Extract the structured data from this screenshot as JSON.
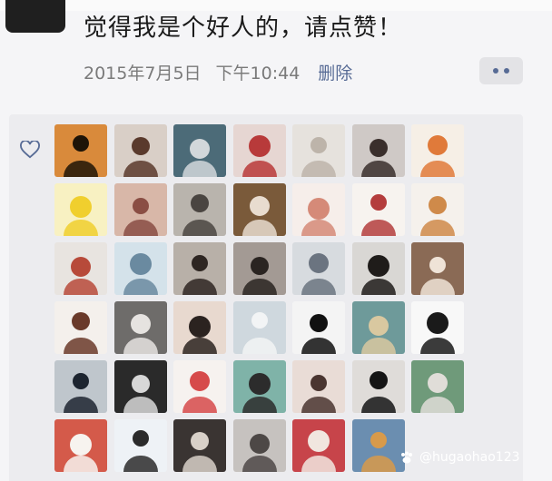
{
  "post": {
    "text": "觉得我是个好人的，请点赞！",
    "date": "2015年7月5日",
    "time": "下午10:44",
    "delete_label": "删除",
    "more_icon": "more-dots-icon"
  },
  "likes": {
    "icon": "heart-outline-icon",
    "avatars": [
      {
        "name": "avatar-buddha-sunset",
        "bg": "#d98a3b",
        "fg": "#1e1407"
      },
      {
        "name": "avatar-girl-portrait",
        "bg": "#d9cfc7",
        "fg": "#5a3a2c"
      },
      {
        "name": "avatar-boy-glasses",
        "bg": "#4c6b78",
        "fg": "#d2d7da"
      },
      {
        "name": "avatar-girl-red",
        "bg": "#e6d6d2",
        "fg": "#b83a3a"
      },
      {
        "name": "avatar-white-cat",
        "bg": "#e6e2dd",
        "fg": "#bdb4aa"
      },
      {
        "name": "avatar-woman-selfie",
        "bg": "#cfc9c6",
        "fg": "#3a2f2c"
      },
      {
        "name": "avatar-cartoon-girl",
        "bg": "#f6efe6",
        "fg": "#e07a3a"
      },
      {
        "name": "avatar-yellow-figure",
        "bg": "#f8f1c2",
        "fg": "#f0cf2e"
      },
      {
        "name": "avatar-group-photo",
        "bg": "#d8b7a8",
        "fg": "#8a4e44"
      },
      {
        "name": "avatar-man-hat",
        "bg": "#b9b4ad",
        "fg": "#4a4541"
      },
      {
        "name": "avatar-chocolate-box",
        "bg": "#7a5a3a",
        "fg": "#e8dccf"
      },
      {
        "name": "avatar-pink-logo",
        "bg": "#f6eeea",
        "fg": "#d58a78"
      },
      {
        "name": "avatar-hanzi-art",
        "bg": "#f7f3ef",
        "fg": "#b43d3d"
      },
      {
        "name": "avatar-cartoon-man",
        "bg": "#f5f1ec",
        "fg": "#cf8a4a"
      },
      {
        "name": "avatar-boy-red",
        "bg": "#e8e4e0",
        "fg": "#b74a3a"
      },
      {
        "name": "avatar-beach-figure",
        "bg": "#d4e2ea",
        "fg": "#6a8aa0"
      },
      {
        "name": "avatar-sunglasses-girl",
        "bg": "#b8b0a8",
        "fg": "#2e2622"
      },
      {
        "name": "avatar-woman-bw",
        "bg": "#a39a94",
        "fg": "#2a2421"
      },
      {
        "name": "avatar-kid-hat",
        "bg": "#d7dbdf",
        "fg": "#6b7480"
      },
      {
        "name": "avatar-sitting-woman",
        "bg": "#d9d7d4",
        "fg": "#1f1c1a"
      },
      {
        "name": "avatar-cafe-woman",
        "bg": "#8a6a55",
        "fg": "#efe3d7"
      },
      {
        "name": "avatar-baby-cartoon",
        "bg": "#f4f0ec",
        "fg": "#6a3a2a"
      },
      {
        "name": "avatar-man-bw",
        "bg": "#6e6c6a",
        "fg": "#e6e3e0"
      },
      {
        "name": "avatar-baby-face",
        "bg": "#e8d9cf",
        "fg": "#2b2320"
      },
      {
        "name": "avatar-seagull",
        "bg": "#cfd8de",
        "fg": "#f2f4f5"
      },
      {
        "name": "avatar-mountain-logo",
        "bg": "#f4f4f4",
        "fg": "#111111"
      },
      {
        "name": "avatar-sea-rock",
        "bg": "#6e9a9a",
        "fg": "#d9c8a0"
      },
      {
        "name": "avatar-sketch-person",
        "bg": "#f8f8f8",
        "fg": "#1a1a1a"
      },
      {
        "name": "avatar-man-suit",
        "bg": "#bfc6cc",
        "fg": "#1d2530"
      },
      {
        "name": "avatar-bw-girl",
        "bg": "#2a2a2a",
        "fg": "#d7d7d7"
      },
      {
        "name": "avatar-red-mouth-girl",
        "bg": "#f6f2ef",
        "fg": "#d64a4a"
      },
      {
        "name": "avatar-tiger-badge",
        "bg": "#7fb3a8",
        "fg": "#2c2c2c"
      },
      {
        "name": "avatar-face-closeup",
        "bg": "#e9dcd6",
        "fg": "#4a3530"
      },
      {
        "name": "avatar-peace-hair",
        "bg": "#dfdcd9",
        "fg": "#151515"
      },
      {
        "name": "avatar-window-plant",
        "bg": "#6f9a7a",
        "fg": "#e0ddd8"
      },
      {
        "name": "avatar-boy-white",
        "bg": "#d45a4a",
        "fg": "#f7f3ef"
      },
      {
        "name": "avatar-anime-couple",
        "bg": "#eef2f6",
        "fg": "#2b2b2b"
      },
      {
        "name": "avatar-dark-room",
        "bg": "#3a3432",
        "fg": "#d8d0c8"
      },
      {
        "name": "avatar-grey-pattern",
        "bg": "#c6c2bf",
        "fg": "#4d4846"
      },
      {
        "name": "avatar-girl-bow",
        "bg": "#c7444a",
        "fg": "#f1e6df"
      },
      {
        "name": "avatar-city-sea",
        "bg": "#6b8eb0",
        "fg": "#d89a4a"
      }
    ]
  },
  "watermark": {
    "text": "@hugaohao123",
    "icon": "paw-icon"
  }
}
